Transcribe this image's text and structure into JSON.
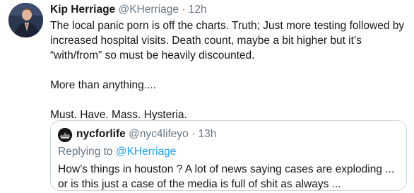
{
  "tweet": {
    "author": {
      "display_name": "Kip Herriage",
      "handle": "@KHerriage",
      "separator": "·",
      "time": "12h"
    },
    "body_lines": [
      "The local panic porn is off the charts. Truth; Just more testing followed by",
      "increased hospital visits. Death count, maybe a bit higher but it’s",
      "“with/from” so must be heavily discounted."
    ],
    "para2": "More than anything....",
    "para3": "Must. Have. Mass. Hysteria."
  },
  "quoted_tweet": {
    "author": {
      "display_name": "nycforlife",
      "handle": "@nyc4lifeyo",
      "separator": "·",
      "time": "13h"
    },
    "replying_prefix": "Replying to ",
    "replying_mention": "@KHerriage",
    "body_lines": [
      "How’s things in houston ? A lot of news saying cases are exploding ...",
      "or is this just a case of the media is full of shit as always ..."
    ]
  }
}
